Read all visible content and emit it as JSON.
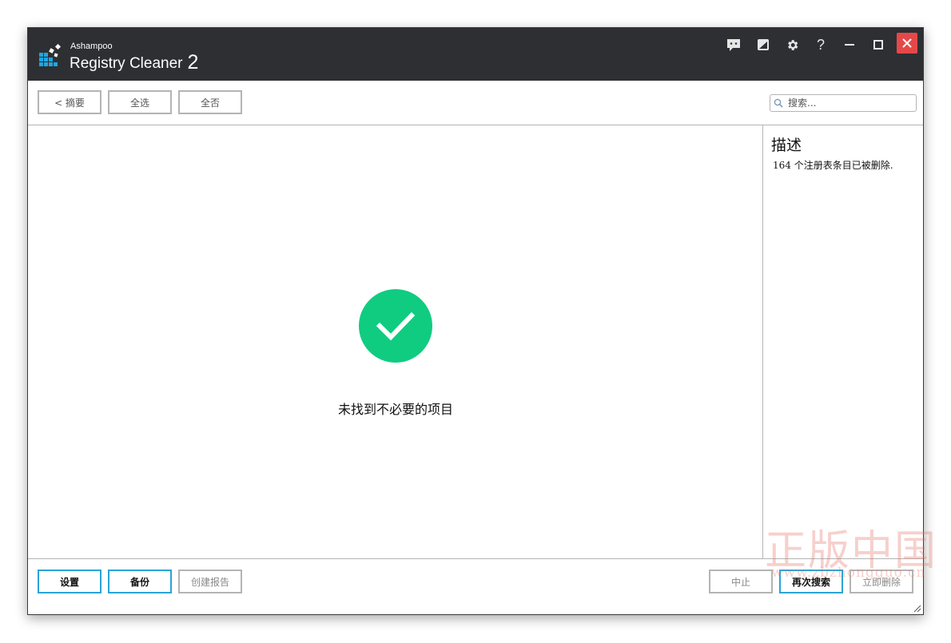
{
  "app": {
    "brand_small": "Ashampoo",
    "brand_name": "Registry Cleaner",
    "brand_version": "2"
  },
  "titlebar": {
    "icons": [
      "feedback-icon",
      "skin-icon",
      "gear-icon",
      "help-icon",
      "minimize-icon",
      "maximize-icon",
      "close-icon"
    ],
    "help_glyph": "?"
  },
  "toolbar": {
    "summary_label": "< 摘要",
    "select_all_label": "全选",
    "select_none_label": "全否",
    "search_placeholder": "搜索..."
  },
  "main": {
    "result_text": "未找到不必要的项目",
    "status_icon": "checkmark-icon",
    "status_color": "#10cc80"
  },
  "side": {
    "title": "描述",
    "description": "164 个注册表条目已被删除."
  },
  "footer": {
    "settings_label": "设置",
    "backup_label": "备份",
    "create_report_label": "创建报告",
    "abort_label": "中止",
    "search_again_label": "再次搜索",
    "delete_now_label": "立即删除"
  },
  "watermark": {
    "text": "正版中国",
    "url": "www.zbzhongguo.cn"
  },
  "colors": {
    "titlebar": "#2d2f33",
    "accent": "#2aa3d8",
    "close": "#e54848",
    "success": "#10cc80"
  }
}
